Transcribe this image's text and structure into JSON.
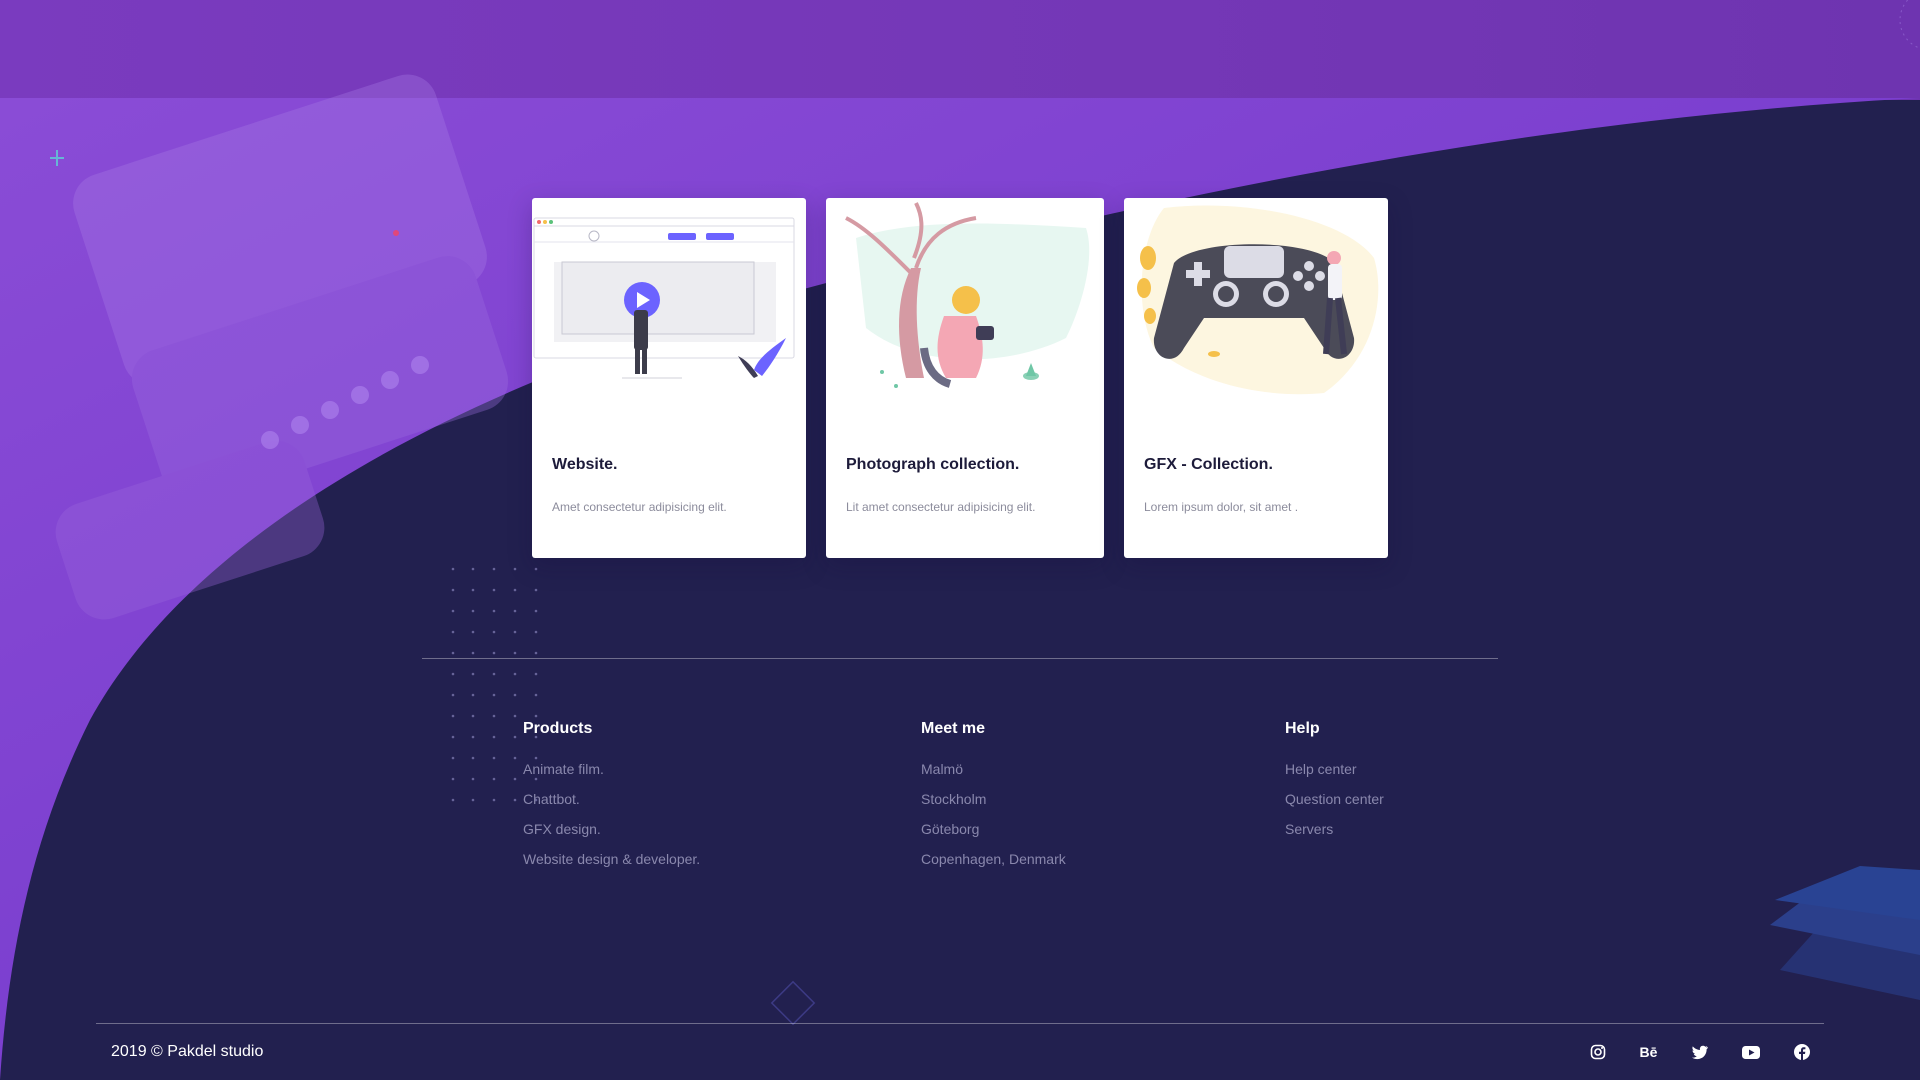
{
  "cards": [
    {
      "title": "Website.",
      "description": "Amet consectetur adipisicing elit.",
      "illustration": "video-website-illustration"
    },
    {
      "title": "Photograph collection.",
      "description": "Lit amet consectetur adipisicing elit.",
      "illustration": "photographer-illustration"
    },
    {
      "title": "GFX - Collection.",
      "description": "Lorem ipsum dolor, sit amet .",
      "illustration": "game-controller-illustration"
    }
  ],
  "footer": {
    "columns": [
      {
        "heading": "Products",
        "links": [
          "Animate film.",
          "Chattbot.",
          "GFX design.",
          "Website design & developer."
        ]
      },
      {
        "heading": "Meet me",
        "links": [
          "Malmö",
          "Stockholm",
          "Göteborg",
          "Copenhagen, Denmark"
        ]
      },
      {
        "heading": "Help",
        "links": [
          "Help center",
          "Question center",
          "Servers"
        ]
      }
    ],
    "copyright": "2019 © Pakdel studio",
    "socials": [
      {
        "icon": "instagram-icon",
        "glyph": ""
      },
      {
        "icon": "behance-icon",
        "glyph": "Bē"
      },
      {
        "icon": "twitter-icon",
        "glyph": ""
      },
      {
        "icon": "youtube-icon",
        "glyph": ""
      },
      {
        "icon": "facebook-icon",
        "glyph": ""
      }
    ]
  },
  "colors": {
    "background": "#22204f",
    "purple": "#7437b6",
    "accent": "#6c63ff",
    "card": "#ffffff",
    "muted_text": "#8a88ad"
  }
}
